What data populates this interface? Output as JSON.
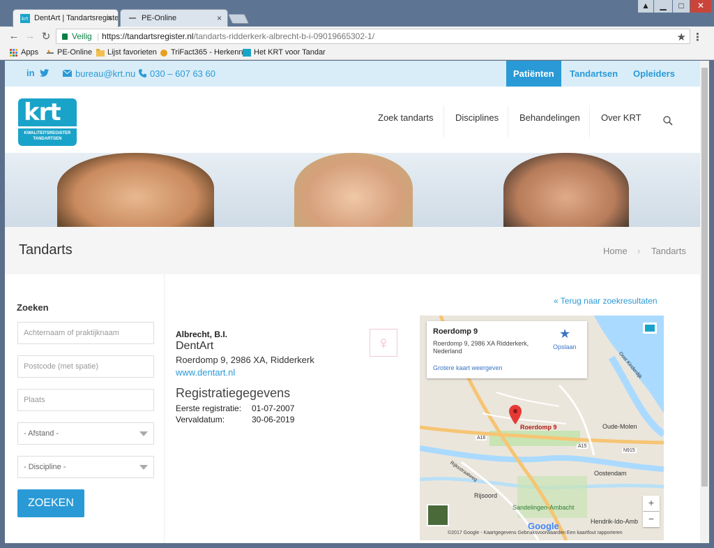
{
  "browser": {
    "tabs": [
      {
        "title": "DentArt | Tandartsregiste",
        "close": "×"
      },
      {
        "title": "PE-Online",
        "close": "×"
      }
    ],
    "secure_label": "Veilig",
    "url_host": "https://tandartsregister.nl",
    "url_path": "/tandarts-ridderkerk-albrecht-b-i-09019665302-1/",
    "star": "★",
    "menu": "⋮",
    "nav": {
      "back": "←",
      "forward": "→",
      "reload": "↻"
    },
    "window_controls": {
      "pin": "▲",
      "minimize": "▁",
      "maximize": "□",
      "close": "✕"
    }
  },
  "bookmarks": [
    {
      "label": "Apps",
      "icon": "apps-grid-icon"
    },
    {
      "label": "PE-Online",
      "icon": "pe-online-icon"
    },
    {
      "label": "Lijst favorieten",
      "icon": "folder-icon"
    },
    {
      "label": "TriFact365 - Herkenn",
      "icon": "trifact-icon"
    },
    {
      "label": "Het KRT voor Tandar",
      "icon": "krt-icon"
    }
  ],
  "topbar": {
    "linkedin": "in",
    "twitter": "t",
    "email": "bureau@krt.nu",
    "phone": "030 – 607 63 60",
    "audience_nav": [
      "Patiënten",
      "Tandartsen",
      "Opleiders"
    ],
    "active_audience": "Patiënten"
  },
  "logo": {
    "text": "krt",
    "sub1": "KWALITEITSREGISTER",
    "sub2": "TANDARTSEN"
  },
  "main_nav": [
    "Zoek tandarts",
    "Disciplines",
    "Behandelingen",
    "Over KRT"
  ],
  "page_title": "Tandarts",
  "breadcrumb": {
    "home": "Home",
    "separator": "›",
    "current": "Tandarts"
  },
  "search": {
    "heading": "Zoeken",
    "name_placeholder": "Achternaam of praktijknaam",
    "postcode_placeholder": "Postcode (met spatie)",
    "city_placeholder": "Plaats",
    "distance_select": "- Afstand -",
    "discipline_select": "- Discipline -",
    "submit": "ZOEKEN"
  },
  "result": {
    "back_link": "« Terug naar zoekresultaten",
    "name": "Albrecht, B.I.",
    "practice": "DentArt",
    "address": "Roerdomp 9, 2986 XA, Ridderkerk",
    "website": "www.dentart.nl",
    "gender_symbol": "♀",
    "registration_heading": "Registratiegegevens",
    "first_registration_label": "Eerste registratie:",
    "first_registration_value": "01-07-2007",
    "expiry_label": "Vervaldatum:",
    "expiry_value": "30-06-2019"
  },
  "map": {
    "card_title": "Roerdomp 9",
    "card_address": "Roerdomp 9, 2986 XA Ridderkerk, Nederland",
    "card_link": "Grotere kaart weergeven",
    "save": "Opslaan",
    "save_icon": "★",
    "pin_label": "Roerdomp 9",
    "labels": [
      "Oude-Molen",
      "Oostendam",
      "Rijsoord",
      "Sandelingen-Ambacht",
      "Hendrik-Ido-Amb",
      "A16",
      "A15",
      "N915",
      "Rijksstraatweg",
      "Oost Kinderdijk"
    ],
    "google": "Google",
    "footer": "©2017 Google - Kaartgegevens    Gebruiksvoorwaarden    Een kaartfout rapporteren",
    "zoom_in": "+",
    "zoom_out": "−"
  },
  "colors": {
    "brand": "#2a9ad6",
    "logo": "#1aa3c9",
    "topbar_bg": "#d9edf8"
  }
}
